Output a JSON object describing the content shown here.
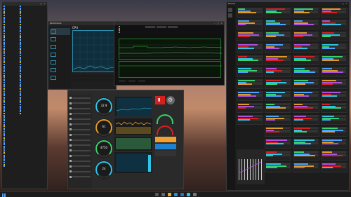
{
  "colors": {
    "accent_blue": "#4aa3ff",
    "cpu_graph": "#2a8fb0",
    "green_graph": "#1f7a2a",
    "gauge_cyan": "#2ec4e6",
    "gauge_orange": "#e09a2a",
    "gauge_green": "#3ad06a",
    "alert_red": "#d62020",
    "info_orange": "#f0a030",
    "info_blue": "#2080d0"
  },
  "explorer": {
    "title": "",
    "items": [
      "",
      "",
      "",
      "",
      "",
      "",
      "",
      "",
      "",
      "",
      "",
      "",
      "",
      "",
      "",
      "",
      "",
      "",
      "",
      "",
      "",
      "",
      "",
      "",
      "",
      "",
      "",
      "",
      "",
      "",
      "",
      "",
      "",
      "",
      "",
      "",
      "",
      "",
      "",
      "",
      "",
      "",
      "",
      "",
      "",
      "",
      "",
      "",
      "",
      "",
      "",
      "",
      "",
      "",
      "",
      "",
      "",
      "",
      "",
      "",
      "",
      "",
      "",
      "",
      "",
      "",
      "",
      "",
      "",
      "",
      "",
      "",
      "",
      "",
      "",
      "",
      "",
      "",
      "",
      "",
      "",
      "",
      "",
      "",
      "",
      "",
      "",
      "",
      ""
    ]
  },
  "taskmgr": {
    "title": "Performance",
    "cpu_label": "CPU",
    "sidebar": [
      "",
      "",
      "",
      "",
      "",
      "",
      ""
    ]
  },
  "graph_window": {
    "title": ""
  },
  "dashboard": {
    "gauges": [
      {
        "value": "32.9",
        "color_key": "gauge_cyan"
      },
      {
        "value": "61",
        "color_key": "gauge_orange"
      },
      {
        "value": "4750",
        "color_key": "gauge_green"
      },
      {
        "value": "24",
        "color_key": "gauge_cyan"
      }
    ]
  },
  "sensors": {
    "title": "Sensors",
    "columns": 4
  },
  "taskbar": {
    "time": "",
    "date": ""
  }
}
